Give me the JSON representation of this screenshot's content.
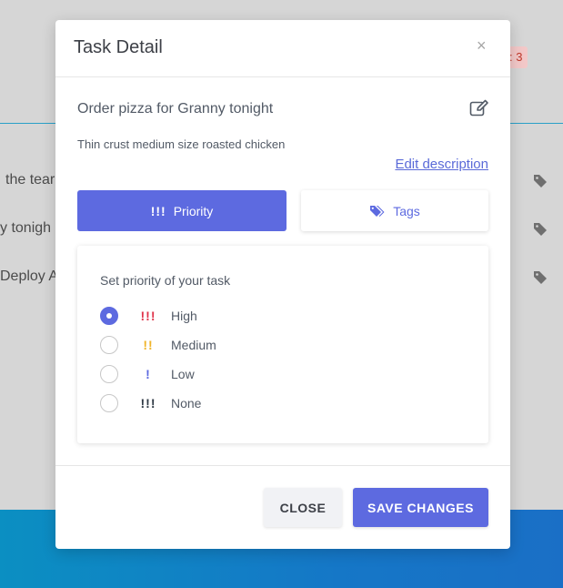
{
  "background": {
    "rows": [
      {
        "text": "the tear"
      },
      {
        "text": "y tonigh"
      },
      {
        "text": "Deploy A"
      }
    ],
    "badge": ": 3"
  },
  "modal": {
    "title": "Task Detail",
    "close_symbol": "×",
    "task_title": "Order pizza for Granny tonight",
    "task_description": "Thin crust medium size roasted chicken",
    "edit_description_label": "Edit description",
    "tabs": [
      {
        "label": "Priority",
        "icon": "!!!",
        "active": true
      },
      {
        "label": "Tags",
        "icon": "tags-icon",
        "active": false
      }
    ],
    "priority_panel": {
      "heading": "Set priority of your task",
      "options": [
        {
          "bangs": "!!!",
          "label": "High",
          "color": "#e0344b",
          "selected": true
        },
        {
          "bangs": "!!",
          "label": "Medium",
          "color": "#f0b429",
          "selected": false
        },
        {
          "bangs": "!",
          "label": "Low",
          "color": "#5d6ae0",
          "selected": false
        },
        {
          "bangs": "!!!",
          "label": "None",
          "color": "#2f3a45",
          "selected": false
        }
      ]
    },
    "footer": {
      "close_label": "CLOSE",
      "save_label": "SAVE CHANGES"
    }
  },
  "colors": {
    "accent": "#5d6ae0",
    "high": "#e0344b",
    "medium": "#f0b429",
    "low": "#5d6ae0",
    "none": "#2f3a45"
  }
}
